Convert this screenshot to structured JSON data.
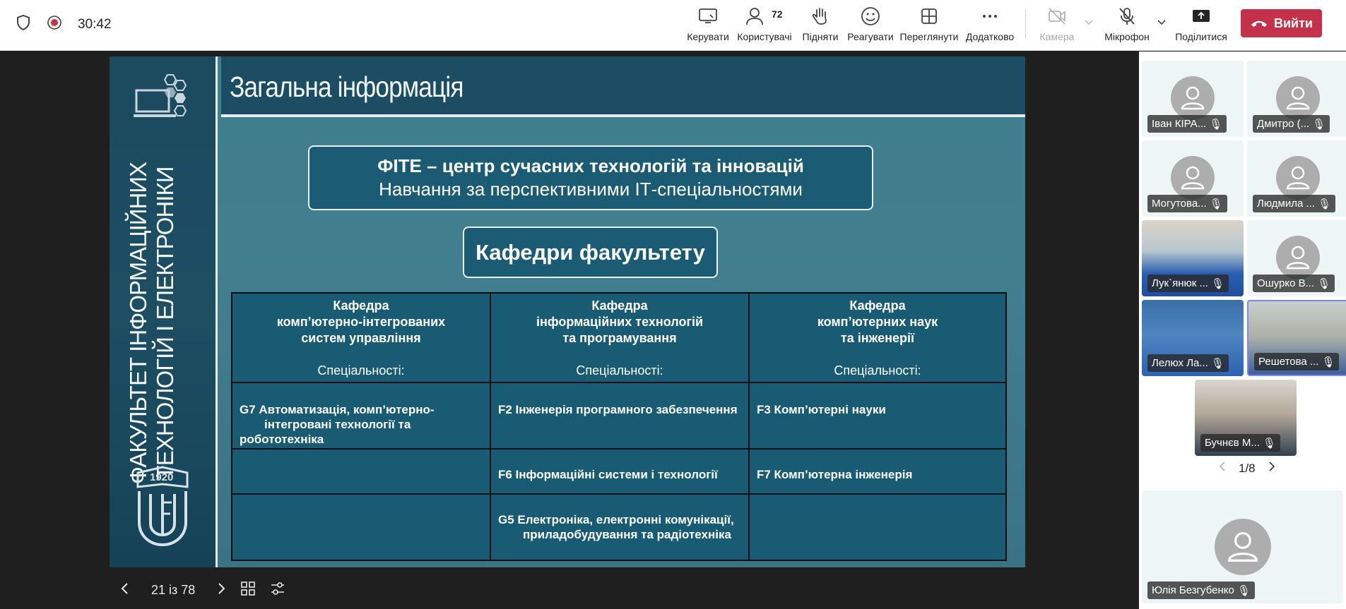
{
  "meeting": {
    "timer": "30:42"
  },
  "toolbar": {
    "items": [
      {
        "label": "Керувати",
        "icon": "present-icon"
      },
      {
        "label": "Користувачі",
        "icon": "people-icon",
        "count": "72"
      },
      {
        "label": "Підняти",
        "icon": "raise-hand-icon"
      },
      {
        "label": "Реагувати",
        "icon": "react-icon"
      },
      {
        "label": "Переглянути",
        "icon": "view-icon"
      },
      {
        "label": "Додатково",
        "icon": "more-icon"
      }
    ],
    "camera": "Камера",
    "mic": "Мікрофон",
    "share": "Поділитися",
    "leave": "Вийти",
    "leave_color": "#c4314b"
  },
  "slide": {
    "side_title": "ФАКУЛЬТЕТ ІНФОРМАЦІЙНИХ ТЕХНОЛОГІЙ І ЕЛЕКТРОНІКИ",
    "logo_year": "1920",
    "title": "Загальна інформація",
    "box1_line1": "ФІТЕ – центр сучасних технологій та інновацій",
    "box1_line2": "Навчання за перспективними ІТ-спеціальностями",
    "box2": "Кафедри факультету",
    "spec_label": "Спеціальності:",
    "departments": [
      {
        "l1": "Кафедра",
        "l2": "комп’ютерно-інтегрованих",
        "l3": "систем управління"
      },
      {
        "l1": "Кафедра",
        "l2": "інформаційних технологій",
        "l3": "та програмування"
      },
      {
        "l1": "Кафедра",
        "l2": "комп’ютерних наук",
        "l3": "та інженерії"
      }
    ],
    "cells": {
      "g7_a": "G7  Автоматизація, комп’ютерно-",
      "g7_b": "інтегровані технології та",
      "g7_c": "робототехніка",
      "f2": "F2  Інженерія програмного забезпечення",
      "f3": "F3  Комп’ютерні науки",
      "f6": "F6  Інформаційні системи і технології",
      "f7": "F7  Комп’ютерна інженерія",
      "g5_a": "G5  Електроніка, електронні комунікації,",
      "g5_b": "приладобудування та радіотехніка"
    },
    "colors": {
      "bg": "#3d7d8d",
      "header": "#1d4d62",
      "box": "#1b5b74"
    }
  },
  "slide_nav": {
    "position": "21 із 78"
  },
  "participants": {
    "tiles": [
      {
        "name": "Іван КІРА..."
      },
      {
        "name": "Дмитро (..."
      },
      {
        "name": "Могутова..."
      },
      {
        "name": "Людмила ..."
      },
      {
        "name": "Лук`янюк ..."
      },
      {
        "name": "Ошурко В..."
      },
      {
        "name": "Лелюх Ла..."
      },
      {
        "name": "Решетова ..."
      },
      {
        "name": "Бучнєв М..."
      }
    ],
    "pager": "1/8",
    "bottom_name": "Юлія Безгубенко"
  }
}
